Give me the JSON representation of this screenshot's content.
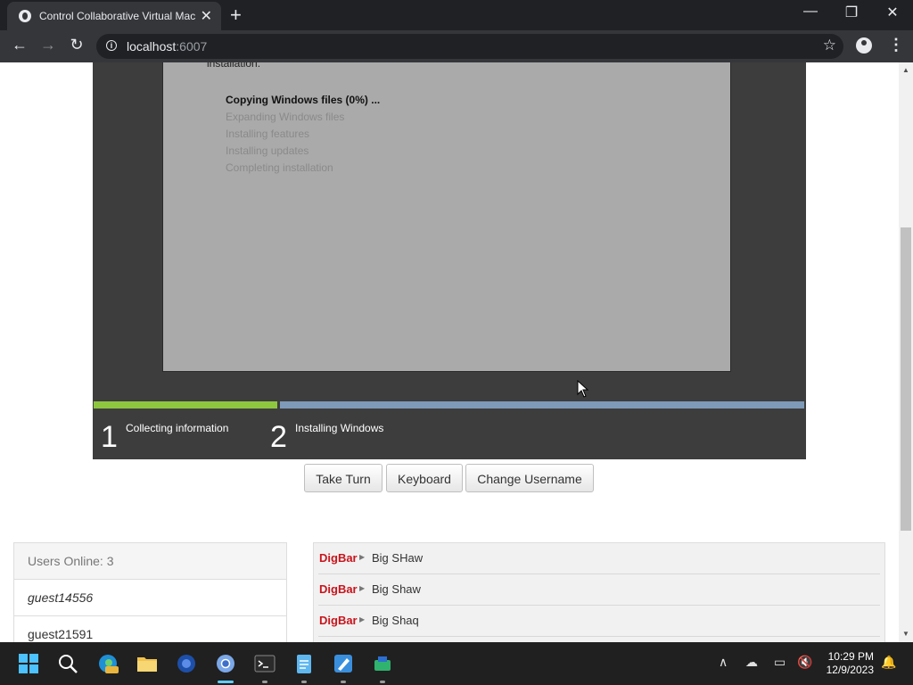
{
  "browser": {
    "tab_title": "Control Collaborative Virtual Mac",
    "url_host": "localhost",
    "url_port": ":6007"
  },
  "vm": {
    "cutoff_text": "installation.",
    "steps": [
      {
        "label": "Copying Windows files (0%) ...",
        "active": true
      },
      {
        "label": "Expanding Windows files",
        "active": false
      },
      {
        "label": "Installing features",
        "active": false
      },
      {
        "label": "Installing updates",
        "active": false
      },
      {
        "label": "Completing installation",
        "active": false
      }
    ],
    "phases": [
      {
        "num": "1",
        "label": "Collecting information"
      },
      {
        "num": "2",
        "label": "Installing Windows"
      }
    ],
    "colors": {
      "progress_done": "#8ec63f",
      "progress_todo": "#7e9ab8",
      "background": "#3d3d3d"
    }
  },
  "controls": {
    "take_turn": "Take Turn",
    "keyboard": "Keyboard",
    "change_username": "Change Username"
  },
  "users": {
    "header": "Users Online: 3",
    "list": [
      "guest14556",
      "guest21591"
    ]
  },
  "chat": {
    "messages": [
      {
        "name": "DigBar",
        "text": "Big SHaw"
      },
      {
        "name": "DigBar",
        "text": "Big Shaw"
      },
      {
        "name": "DigBar",
        "text": "Big Shaq"
      }
    ],
    "name_color": "#c9141c"
  },
  "taskbar": {
    "icons": [
      "windows-start-icon",
      "search-icon",
      "edge-preview-icon",
      "file-explorer-icon",
      "firefox-icon",
      "chrome-icon",
      "terminal-icon",
      "notepad-icon",
      "paint-icon",
      "app-icon"
    ],
    "time": "10:29 PM",
    "date": "12/9/2023"
  }
}
